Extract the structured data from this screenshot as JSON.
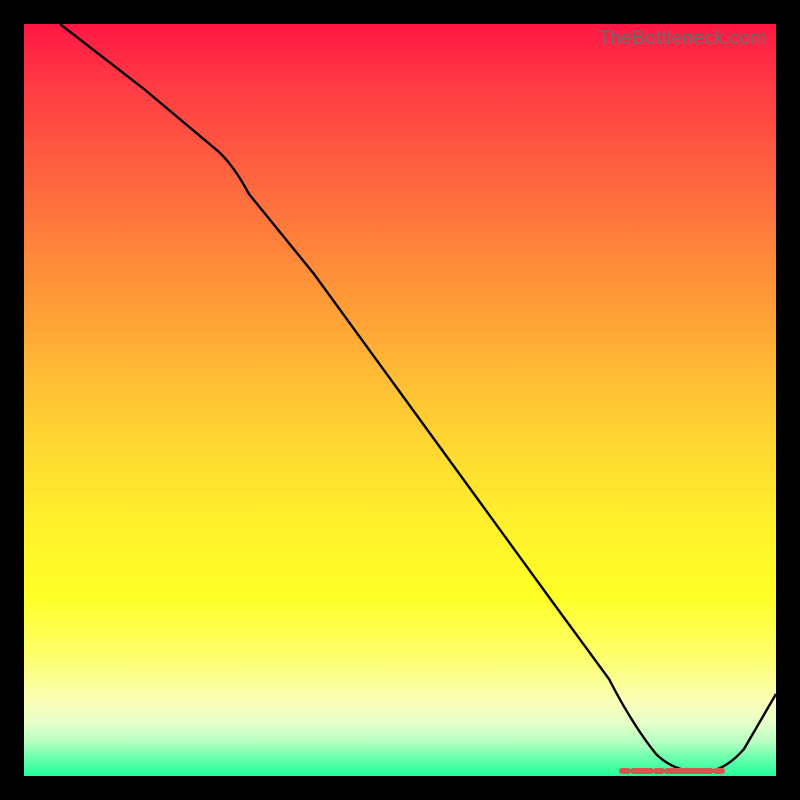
{
  "watermark": "TheBottleneck.com",
  "chart_data": {
    "type": "line",
    "title": "",
    "xlabel": "",
    "ylabel": "",
    "xlim": [
      0,
      100
    ],
    "ylim": [
      0,
      100
    ],
    "series": [
      {
        "name": "curve",
        "x": [
          0,
          10,
          20,
          30,
          40,
          50,
          60,
          70,
          78,
          82,
          86,
          90,
          94,
          100
        ],
        "values": [
          100,
          92,
          84,
          74,
          62,
          50,
          38,
          26,
          13,
          5,
          1,
          1,
          3,
          12
        ]
      }
    ],
    "marker_range": {
      "x_start": 78,
      "x_end": 90,
      "y": 1
    }
  }
}
